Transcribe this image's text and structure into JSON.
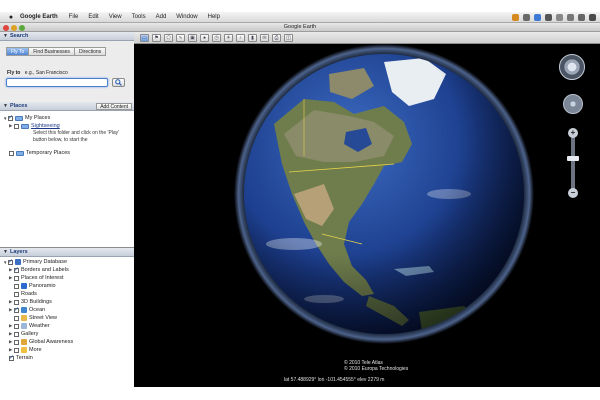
{
  "menubar": {
    "app_name": "Google Earth",
    "items": [
      "File",
      "Edit",
      "View",
      "Tools",
      "Add",
      "Window",
      "Help"
    ]
  },
  "window": {
    "title": "Google Earth"
  },
  "search": {
    "header": "Search",
    "tabs": [
      "Fly To",
      "Find Businesses",
      "Directions"
    ],
    "fly_label": "Fly to",
    "fly_hint": "e.g., San Francisco",
    "input_value": ""
  },
  "places": {
    "header": "Places",
    "add_content": "Add Content",
    "my_places": "My Places",
    "sightseeing": "Sightseeing",
    "sightseeing_desc": "Select this folder and click on the 'Play' button below, to start the",
    "temporary": "Temporary Places"
  },
  "layers": {
    "header": "Layers",
    "items": [
      "Primary Database",
      "Borders and Labels",
      "Places of Interest",
      "Panoramio",
      "Roads",
      "3D Buildings",
      "Ocean",
      "Street View",
      "Weather",
      "Gallery",
      "Global Awareness",
      "More",
      "Terrain"
    ]
  },
  "map": {
    "attribution_1": "© 2010 Tele Atlas",
    "attribution_2": "© 2010 Europa Technologies",
    "status": "lat  57.488929° lon -101.454555°  elev 2279 m"
  },
  "colors": {
    "accent": "#4f86d6",
    "ocean": "#1f3f8c",
    "land": "#6a7a4a"
  }
}
